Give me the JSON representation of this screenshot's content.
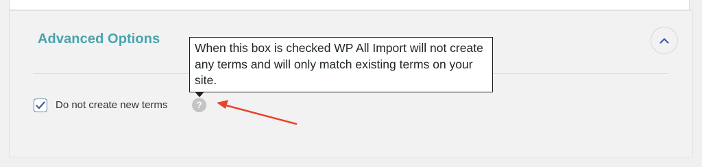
{
  "section": {
    "title": "Advanced Options",
    "collapse_icon": "chevron-up-icon"
  },
  "option": {
    "label": "Do not create new terms",
    "checked": true,
    "help_icon": "question-mark-icon",
    "help_glyph": "?"
  },
  "tooltip": {
    "text": "When this box is checked WP All Import will not create any terms and will only match existing terms on your site."
  },
  "colors": {
    "title": "#46a4ad",
    "annotation_arrow": "#e8432d",
    "checkbox_border": "#5b7ea8"
  }
}
